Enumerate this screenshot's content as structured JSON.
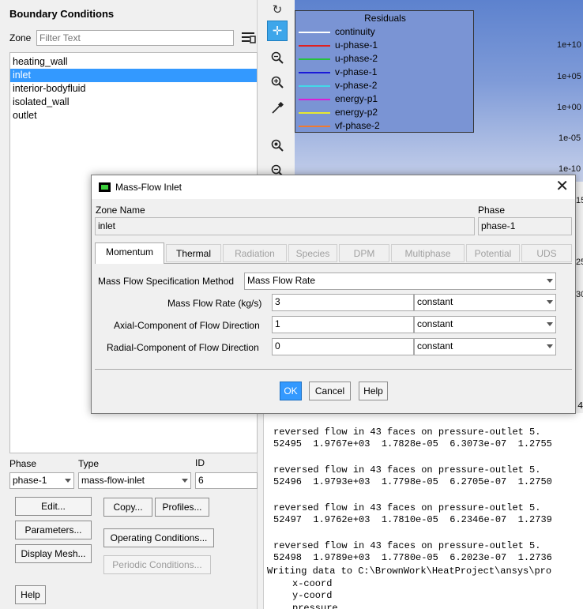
{
  "left": {
    "title": "Boundary Conditions",
    "zone_label": "Zone",
    "filter_placeholder": "Filter Text",
    "zones": [
      "heating_wall",
      "inlet",
      "interior-bodyfluid",
      "isolated_wall",
      "outlet"
    ],
    "selected_zone": "inlet",
    "phase_label": "Phase",
    "type_label": "Type",
    "id_label": "ID",
    "phase_value": "phase-1",
    "type_value": "mass-flow-inlet",
    "id_value": "6",
    "buttons": {
      "edit": "Edit...",
      "copy": "Copy...",
      "profiles": "Profiles...",
      "parameters": "Parameters...",
      "operating": "Operating Conditions...",
      "display_mesh": "Display Mesh...",
      "periodic": "Periodic Conditions...",
      "help": "Help"
    }
  },
  "toolbar": {
    "icons": [
      "refresh-icon",
      "move-icon",
      "zoom-icon",
      "zoom-in-icon",
      "probe-icon",
      "zoom-fit-icon",
      "zoom-out-icon"
    ],
    "active": "move-icon"
  },
  "graphics": {
    "legend_title": "Residuals",
    "legend": [
      {
        "name": "continuity",
        "color": "#ffffff"
      },
      {
        "name": "u-phase-1",
        "color": "#e02020"
      },
      {
        "name": "u-phase-2",
        "color": "#25c23a"
      },
      {
        "name": "v-phase-1",
        "color": "#1a1ad8"
      },
      {
        "name": "v-phase-2",
        "color": "#43d8e8"
      },
      {
        "name": "energy-p1",
        "color": "#d81fd8"
      },
      {
        "name": "energy-p2",
        "color": "#e8e830"
      },
      {
        "name": "vf-phase-2",
        "color": "#f07a30"
      }
    ],
    "y_ticks": [
      "1e+10",
      "1e+05",
      "1e+00",
      "1e-05",
      "1e-10"
    ],
    "partial_right_labels": [
      "15",
      "25",
      "30"
    ]
  },
  "console": {
    "lines": [
      {
        "text": "reversed flow in 43 faces on pressure-outlet 5.",
        "cls": ""
      },
      {
        "text": "52495  1.9767e+03  1.7828e-05  6.3073e-07  1.2755",
        "cls": ""
      },
      {
        "text": "reversed flow in 43 faces on pressure-outlet 5.",
        "cls": ""
      },
      {
        "text": "52496  1.9793e+03  1.7798e-05  6.2705e-07  1.2750",
        "cls": ""
      },
      {
        "text": "reversed flow in 43 faces on pressure-outlet 5.",
        "cls": ""
      },
      {
        "text": "52497  1.9762e+03  1.7810e-05  6.2346e-07  1.2739",
        "cls": ""
      },
      {
        "text": "reversed flow in 43 faces on pressure-outlet 5.",
        "cls": ""
      },
      {
        "text": "52498  1.9789e+03  1.7780e-05  6.2023e-07  1.2736",
        "cls": ""
      },
      {
        "text": "Writing data to C:\\BrownWork\\HeatProject\\ansys\\pro",
        "cls": "noind"
      },
      {
        "text": "x-coord",
        "cls": "ind"
      },
      {
        "text": "y-coord",
        "cls": "ind"
      },
      {
        "text": "pressure",
        "cls": "ind"
      }
    ],
    "edge_char": "4"
  },
  "dialog": {
    "title": "Mass-Flow Inlet",
    "zone_name_label": "Zone Name",
    "zone_name": "inlet",
    "phase_label": "Phase",
    "phase": "phase-1",
    "tabs": [
      {
        "label": "Momentum",
        "state": "active"
      },
      {
        "label": "Thermal",
        "state": "enabled"
      },
      {
        "label": "Radiation",
        "state": "disabled"
      },
      {
        "label": "Species",
        "state": "disabled"
      },
      {
        "label": "DPM",
        "state": "disabled"
      },
      {
        "label": "Multiphase",
        "state": "disabled"
      },
      {
        "label": "Potential",
        "state": "disabled"
      },
      {
        "label": "UDS",
        "state": "disabled"
      }
    ],
    "spec_method_label": "Mass Flow Specification Method",
    "spec_method": "Mass Flow Rate",
    "mass_flow_label": "Mass Flow Rate (kg/s)",
    "mass_flow_value": "3",
    "mass_flow_mode": "constant",
    "axial_label": "Axial-Component of Flow Direction",
    "axial_value": "1",
    "axial_mode": "constant",
    "radial_label": "Radial-Component of Flow Direction",
    "radial_value": "0",
    "radial_mode": "constant",
    "ok": "OK",
    "cancel": "Cancel",
    "help": "Help"
  }
}
